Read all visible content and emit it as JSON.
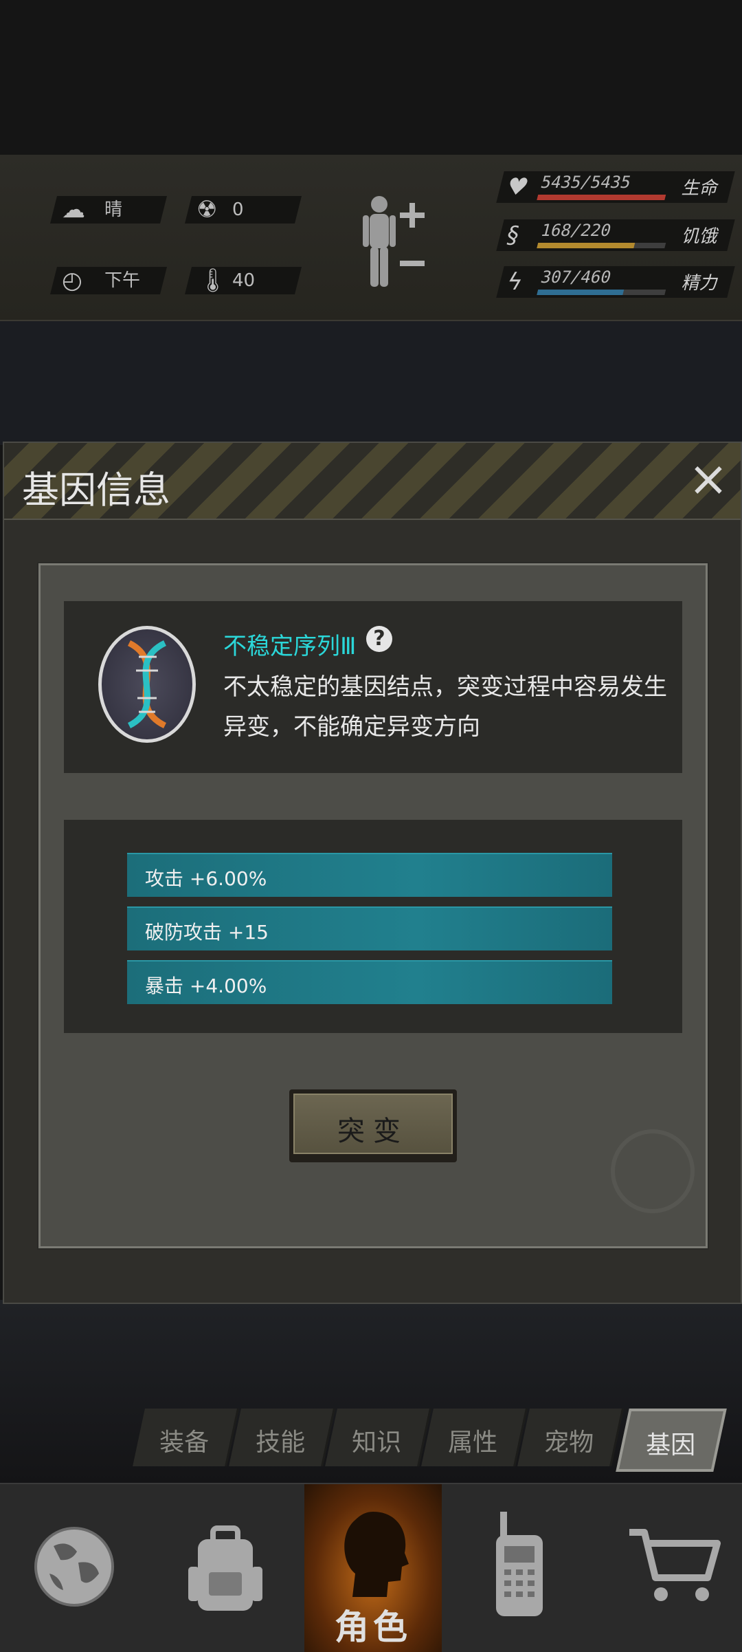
{
  "status": {
    "weather": {
      "icon": "cloud-icon",
      "label": "晴"
    },
    "radiation": {
      "icon": "radiation-icon",
      "value": "0"
    },
    "time": {
      "icon": "clock-icon",
      "label": "下午"
    },
    "temperature": {
      "icon": "thermometer-icon",
      "value": "40"
    },
    "body_icon": "body-figure-icon",
    "stats": [
      {
        "name": "health",
        "icon": "heart-icon",
        "value": "5435/5435",
        "label": "生命",
        "fill": 1.0,
        "color": "#b23a30"
      },
      {
        "name": "hunger",
        "icon": "stomach-icon",
        "value": "168/220",
        "label": "饥饿",
        "fill": 0.76,
        "color": "#b38a2e"
      },
      {
        "name": "energy",
        "icon": "brain-icon",
        "value": "307/460",
        "label": "精力",
        "fill": 0.67,
        "color": "#2f6e93"
      }
    ]
  },
  "modal": {
    "title": "基因信息",
    "gene": {
      "name": "不稳定序列Ⅲ",
      "description": "不太稳定的基因结点，突变过程中容易发生异变，不能确定异变方向",
      "emblem": "dna-icon"
    },
    "attributes": [
      {
        "text": "攻击 +6.00%"
      },
      {
        "text": "破防攻击 +15"
      },
      {
        "text": "暴击 +4.00%"
      }
    ],
    "mutate_label": "突变"
  },
  "tabs": [
    {
      "label": "装备",
      "active": false
    },
    {
      "label": "技能",
      "active": false
    },
    {
      "label": "知识",
      "active": false
    },
    {
      "label": "属性",
      "active": false
    },
    {
      "label": "宠物",
      "active": false
    },
    {
      "label": "基因",
      "active": true
    }
  ],
  "nav": {
    "role_label": "角色",
    "items": [
      "globe-icon",
      "backpack-icon",
      "head-silhouette-icon",
      "walkie-talkie-icon",
      "cart-icon"
    ]
  }
}
